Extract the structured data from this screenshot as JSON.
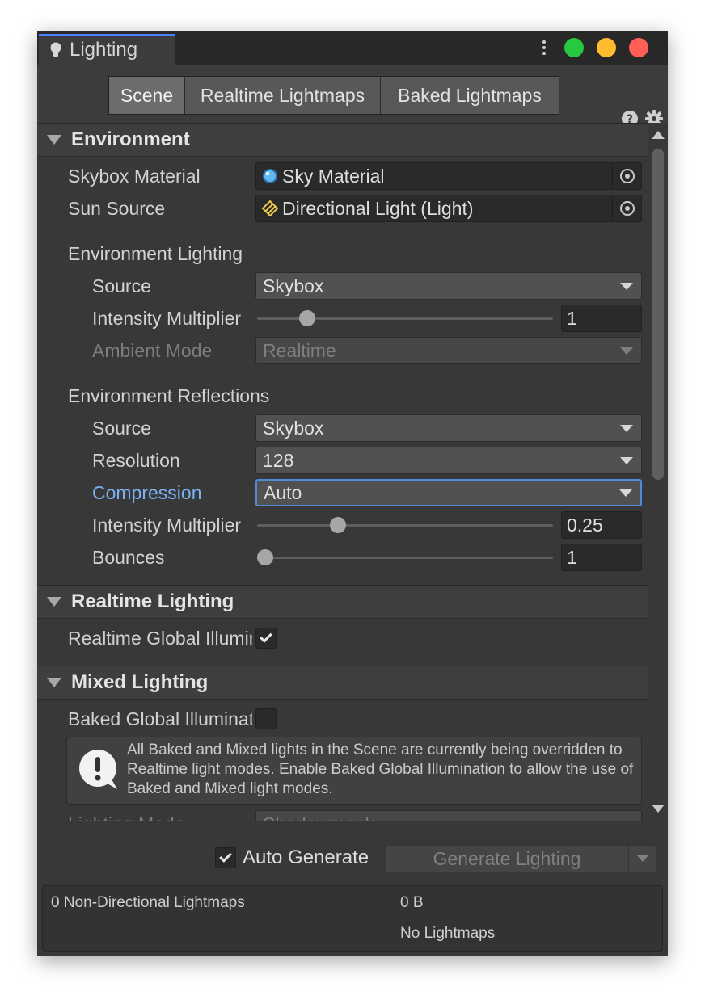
{
  "window": {
    "tab_title": "Lighting",
    "traffic_colors": [
      "#28c840",
      "#febc2e",
      "#ff5f57"
    ]
  },
  "toolbar": {
    "tabs": [
      {
        "label": "Scene",
        "active": true
      },
      {
        "label": "Realtime Lightmaps",
        "active": false
      },
      {
        "label": "Baked Lightmaps",
        "active": false
      }
    ],
    "help_icon": "help-circle-icon",
    "settings_icon": "gear-icon"
  },
  "environment": {
    "header": "Environment",
    "skybox_material": {
      "label": "Skybox Material",
      "value": "Sky Material"
    },
    "sun_source": {
      "label": "Sun Source",
      "value": "Directional Light (Light)"
    },
    "lighting": {
      "header": "Environment Lighting",
      "source": {
        "label": "Source",
        "value": "Skybox"
      },
      "intensity": {
        "label": "Intensity Multiplier",
        "value": "1",
        "fraction": 0.15
      },
      "ambient_mode": {
        "label": "Ambient Mode",
        "value": "Realtime",
        "disabled": true
      }
    },
    "reflections": {
      "header": "Environment Reflections",
      "source": {
        "label": "Source",
        "value": "Skybox"
      },
      "resolution": {
        "label": "Resolution",
        "value": "128"
      },
      "compression": {
        "label": "Compression",
        "value": "Auto"
      },
      "intensity": {
        "label": "Intensity Multiplier",
        "value": "0.25",
        "fraction": 0.26
      },
      "bounces": {
        "label": "Bounces",
        "value": "1",
        "fraction": 0.0
      }
    }
  },
  "realtime_lighting": {
    "header": "Realtime Lighting",
    "gi": {
      "label": "Realtime Global Illumination",
      "checked": true
    }
  },
  "mixed_lighting": {
    "header": "Mixed Lighting",
    "baked_gi": {
      "label": "Baked Global Illumination",
      "checked": false
    },
    "help": "All Baked and Mixed lights in the Scene are currently being overridden to Realtime light modes. Enable Baked Global Illumination to allow the use of Baked and Mixed light modes.",
    "lighting_mode": {
      "label": "Lighting Mode",
      "value": "Shadowmask"
    }
  },
  "bottom": {
    "auto_generate": {
      "label": "Auto Generate",
      "checked": true
    },
    "generate_button": "Generate Lighting",
    "stats": {
      "lightmaps": "0 Non-Directional Lightmaps",
      "size": "0 B",
      "status": "No Lightmaps"
    }
  }
}
